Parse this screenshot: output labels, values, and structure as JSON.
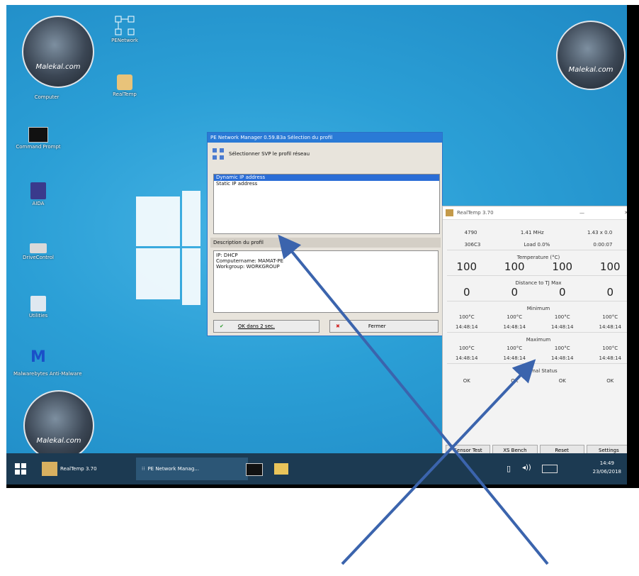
{
  "desktop_icons": [
    {
      "id": "network",
      "label": "PENetwork",
      "icon": "network-icon"
    },
    {
      "id": "realtemp",
      "label": "RealTemp",
      "icon": "realtemp-icon"
    },
    {
      "id": "computer",
      "label": "Computer",
      "icon": "computer-icon"
    },
    {
      "id": "cmd",
      "label": "Command Prompt",
      "icon": "console-icon"
    },
    {
      "id": "aida",
      "label": "AIDA",
      "icon": "aida-icon"
    },
    {
      "id": "drive",
      "label": "DriveControl",
      "icon": "drive-icon"
    },
    {
      "id": "utilities",
      "label": "Utilities",
      "icon": "utilities-icon"
    },
    {
      "id": "malwarebytes",
      "label": "Malwarebytes Anti-Malware",
      "icon": "malwarebytes-icon"
    }
  ],
  "badge_text": "Malekal.com",
  "pe_dialog": {
    "title": "PE Network Manager 0.59.B3a Sélection du profil",
    "header": "Sélectionner SVP le profil réseau",
    "profiles": [
      "Dynamic IP address",
      "Static IP address"
    ],
    "description_header": "Description du profil",
    "description_lines": [
      "IP: DHCP",
      "Computername: MAMAT-PE",
      "Workgroup: WORKGROUP"
    ],
    "ok_label": "OK dans 2 sec.",
    "close_label": "Fermer"
  },
  "realtemp": {
    "title": "RealTemp 3.70",
    "minimize": "—",
    "close": "✕",
    "info_row1": [
      "4790",
      "1.41 MHz",
      "1.43 x 0.0"
    ],
    "info_row2": [
      "306C3",
      "Load 0.0%",
      "0:00:07"
    ],
    "temp_header": "Temperature (°C)",
    "temps": [
      "100",
      "100",
      "100",
      "100"
    ],
    "distance_header": "Distance to TJ Max",
    "distances": [
      "0",
      "0",
      "0",
      "0"
    ],
    "min_header": "Minimum",
    "min_vals": [
      "100°C",
      "100°C",
      "100°C",
      "100°C"
    ],
    "min_times": [
      "14:48:14",
      "14:48:14",
      "14:48:14",
      "14:48:14"
    ],
    "max_header": "Maximum",
    "max_vals": [
      "100°C",
      "100°C",
      "100°C",
      "100°C"
    ],
    "max_times": [
      "14:48:14",
      "14:48:14",
      "14:48:14",
      "14:48:14"
    ],
    "thermal_header": "Thermal Status",
    "thermal": [
      "OK",
      "OK",
      "OK",
      "OK"
    ],
    "buttons": [
      "Sensor Test",
      "XS Bench",
      "Reset",
      "Settings"
    ]
  },
  "taskbar": {
    "items": [
      "RealTemp 3.70",
      "PE Network Manag..."
    ],
    "time": "14:49",
    "date": "23/06/2018"
  },
  "colors": {
    "desktop": "#2b9fd6",
    "titlebar": "#2a7ad6",
    "taskbar": "#1c3a52",
    "arrow": "#3b64ad"
  }
}
